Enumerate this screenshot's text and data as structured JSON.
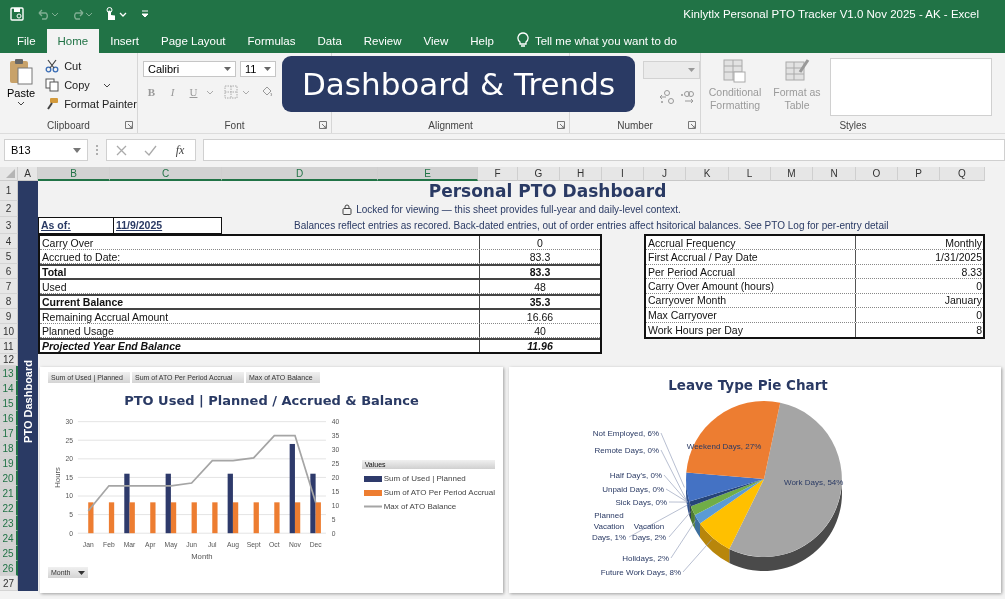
{
  "window": {
    "title": "Kinlytlx Personal PTO Tracker V1.0 Nov 2025 - AK  -  Excel"
  },
  "menu_tabs": [
    {
      "label": "File",
      "selected": false
    },
    {
      "label": "Home",
      "selected": true
    },
    {
      "label": "Insert",
      "selected": false
    },
    {
      "label": "Page Layout",
      "selected": false
    },
    {
      "label": "Formulas",
      "selected": false
    },
    {
      "label": "Data",
      "selected": false
    },
    {
      "label": "Review",
      "selected": false
    },
    {
      "label": "View",
      "selected": false
    },
    {
      "label": "Help",
      "selected": false
    }
  ],
  "tell_me": "Tell me what you want to do",
  "ribbon": {
    "clipboard": {
      "paste": "Paste",
      "cut": "Cut",
      "copy": "Copy",
      "format_painter": "Format Painter",
      "label": "Clipboard"
    },
    "font": {
      "name": "Calibri",
      "size": "11",
      "buttons": [
        "B",
        "I",
        "U"
      ],
      "label": "Font"
    },
    "alignment": {
      "label": "Alignment"
    },
    "number": {
      "format_disabled": true,
      "label": "Number"
    },
    "styles": {
      "buttons": [
        {
          "label": "Conditional Formatting",
          "disabled": true
        },
        {
          "label": "Format as Table",
          "disabled": true
        }
      ],
      "label": "Styles"
    }
  },
  "banner": "Dashboard & Trends",
  "formula_bar": {
    "name_box": "B13",
    "function_button": "fx"
  },
  "columns": [
    {
      "label": "A",
      "selected": false
    },
    {
      "label": "B",
      "selected": true
    },
    {
      "label": "C",
      "selected": true
    },
    {
      "label": "D",
      "selected": true
    },
    {
      "label": "E",
      "selected": true
    },
    {
      "label": "F",
      "selected": false
    },
    {
      "label": "G",
      "selected": false
    },
    {
      "label": "H",
      "selected": false
    },
    {
      "label": "I",
      "selected": false
    },
    {
      "label": "J",
      "selected": false
    },
    {
      "label": "K",
      "selected": false
    },
    {
      "label": "L",
      "selected": false
    },
    {
      "label": "M",
      "selected": false
    },
    {
      "label": "N",
      "selected": false
    },
    {
      "label": "O",
      "selected": false
    },
    {
      "label": "P",
      "selected": false
    },
    {
      "label": "Q",
      "selected": false
    }
  ],
  "rows": [
    {
      "label": "1",
      "selected": false
    },
    {
      "label": "2",
      "selected": false
    },
    {
      "label": "3",
      "selected": false
    },
    {
      "label": "4",
      "selected": false
    },
    {
      "label": "5",
      "selected": false
    },
    {
      "label": "6",
      "selected": false
    },
    {
      "label": "7",
      "selected": false
    },
    {
      "label": "8",
      "selected": false
    },
    {
      "label": "9",
      "selected": false
    },
    {
      "label": "10",
      "selected": false
    },
    {
      "label": "11",
      "selected": false
    },
    {
      "label": "12",
      "selected": false
    },
    {
      "label": "13",
      "selected": true
    },
    {
      "label": "14",
      "selected": true
    },
    {
      "label": "15",
      "selected": true
    },
    {
      "label": "16",
      "selected": true
    },
    {
      "label": "17",
      "selected": true
    },
    {
      "label": "18",
      "selected": true
    },
    {
      "label": "19",
      "selected": true
    },
    {
      "label": "20",
      "selected": true
    },
    {
      "label": "21",
      "selected": true
    },
    {
      "label": "22",
      "selected": true
    },
    {
      "label": "23",
      "selected": true
    },
    {
      "label": "24",
      "selected": true
    },
    {
      "label": "25",
      "selected": true
    },
    {
      "label": "26",
      "selected": true
    },
    {
      "label": "27",
      "selected": false
    }
  ],
  "sheet": {
    "title": "Personal PTO Dashboard",
    "lock_note": "Locked for viewing — this sheet provides full-year and daily-level context.",
    "as_of_label": "As of:",
    "as_of_value": "11/9/2025",
    "note": "Balances reflect entries as recored.  Back-dated entries, out of order entries affect hsitorical balances.  See PTO Log for per-entry detail",
    "side_label": "PTO Dashboard",
    "summary": [
      {
        "label": "Carry Over",
        "value": "0",
        "kind": "normal"
      },
      {
        "label": "Accrued to Date:",
        "value": "83.3",
        "kind": "normal"
      },
      {
        "label": "Total",
        "value": "83.3",
        "kind": "bold"
      },
      {
        "label": "Used",
        "value": "48",
        "kind": "normal"
      },
      {
        "label": "Current Balance",
        "value": "35.3",
        "kind": "bold"
      },
      {
        "label": "Remaining Accrual Amount",
        "value": "16.66",
        "kind": "normal"
      },
      {
        "label": "Planned Usage",
        "value": "40",
        "kind": "normal"
      },
      {
        "label": "Projected Year End Balance",
        "value": "11.96",
        "kind": "italic"
      }
    ],
    "settings": [
      {
        "label": "Accrual Frequency",
        "value": "Monthly"
      },
      {
        "label": "First Accrual / Pay Date",
        "value": "1/31/2025"
      },
      {
        "label": "Per Period Accrual",
        "value": "8.33"
      },
      {
        "label": "Carry Over Amount (hours)",
        "value": "0"
      },
      {
        "label": "Carryover Month",
        "value": "January"
      },
      {
        "label": "Max Carryover",
        "value": "0"
      },
      {
        "label": "Work Hours per Day",
        "value": "8"
      }
    ]
  },
  "bar_chart": {
    "field_buttons": [
      "Sum of Used | Planned",
      "Sum of ATO Per Period Accrual",
      "Max of ATO Balance"
    ],
    "legend_title": "Values",
    "filter_button": "Month",
    "chart_data": {
      "type": "bar",
      "title": "PTO Used | Planned / Accrued & Balance",
      "xlabel": "Month",
      "ylabel": "Hours",
      "categories": [
        "Jan",
        "Feb",
        "Mar",
        "Apr",
        "May",
        "Jun",
        "Jul",
        "Aug",
        "Sept",
        "Oct",
        "Nov",
        "Dec"
      ],
      "series": [
        {
          "name": "Sum of Used | Planned",
          "color": "#2e3a6b",
          "type": "bar",
          "values": [
            0,
            0,
            16,
            0,
            16,
            0,
            0,
            16,
            0,
            0,
            24,
            16
          ]
        },
        {
          "name": "Sum of ATO Per Period Accrual",
          "color": "#ed7d31",
          "type": "bar",
          "values": [
            8.3,
            8.3,
            8.3,
            8.3,
            8.3,
            8.3,
            8.3,
            8.3,
            8.3,
            8.3,
            8.3,
            8.3
          ]
        },
        {
          "name": "Max of ATO Balance",
          "color": "#a5a5a5",
          "type": "line",
          "axis": "y2",
          "values": [
            8,
            17,
            17,
            17,
            17,
            18,
            26,
            26,
            27,
            35,
            35,
            11
          ]
        }
      ],
      "ylim": [
        0,
        30
      ],
      "yticks": [
        0,
        5,
        10,
        15,
        20,
        25,
        30
      ],
      "y2lim": [
        0,
        40
      ],
      "y2ticks": [
        0,
        5,
        10,
        15,
        20,
        25,
        30,
        35,
        40
      ],
      "grid": true
    }
  },
  "pie_chart": {
    "chart_data": {
      "type": "pie",
      "title": "Leave Type Pie Chart",
      "categories": [
        "Work Days, 54%",
        "Future Work Days, 8%",
        "Holidays, 2%",
        "Vacation Days, 2%",
        "Planned Vacation Days, 1%",
        "Sick Days, 0%",
        "Unpaid Days, 0%",
        "Half Day's, 0%",
        "Remote Days, 0%",
        "Not Employed, 6%",
        "Weekend Days, 27%"
      ],
      "series": [
        {
          "values": [
            54,
            8,
            2,
            2,
            1,
            0,
            0,
            0,
            0,
            6,
            27
          ]
        }
      ]
    }
  }
}
